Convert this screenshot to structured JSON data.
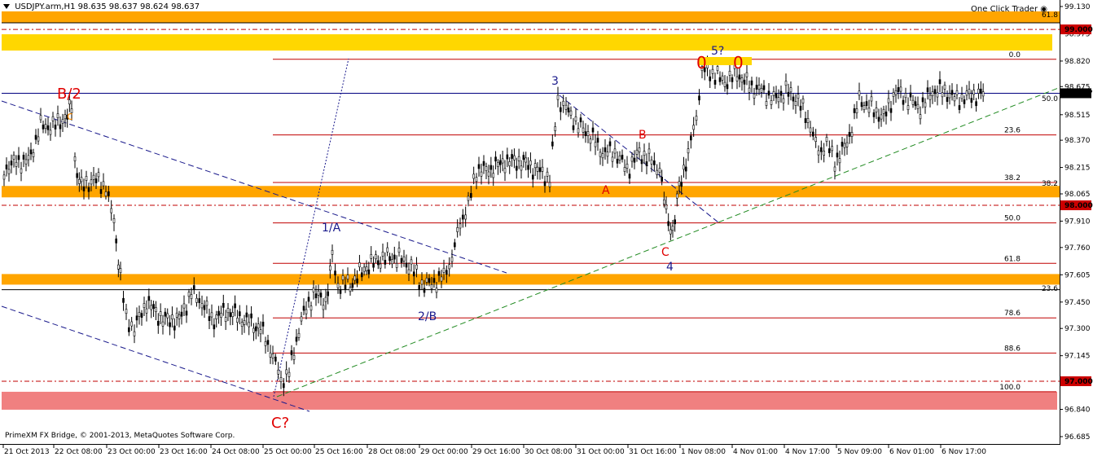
{
  "window": {
    "title": "USDJPY.arm,H1",
    "ohlc": "98.635 98.637 98.624 98.637",
    "one_click": "One Click Trader",
    "copyright": "PrimeXM FX Bridge, © 2001-2013, MetaQuotes Software Corp."
  },
  "price_axis": {
    "ticks": [
      "99.130",
      "98.975",
      "98.820",
      "98.675",
      "98.515",
      "98.370",
      "98.215",
      "98.065",
      "97.910",
      "97.760",
      "97.605",
      "97.450",
      "97.300",
      "97.145",
      "96.990",
      "96.840",
      "96.685"
    ],
    "highlighted": [
      {
        "label": "99.000",
        "bg": "#cc0000"
      },
      {
        "label": "98.637",
        "bg": "#000000"
      },
      {
        "label": "98.000",
        "bg": "#cc0000"
      },
      {
        "label": "97.000",
        "bg": "#cc0000"
      }
    ]
  },
  "time_axis": {
    "ticks": [
      "21 Oct 2013",
      "22 Oct 08:00",
      "23 Oct 00:00",
      "23 Oct 16:00",
      "24 Oct 08:00",
      "25 Oct 00:00",
      "25 Oct 16:00",
      "28 Oct 08:00",
      "29 Oct 00:00",
      "29 Oct 16:00",
      "30 Oct 08:00",
      "31 Oct 00:00",
      "31 Oct 16:00",
      "1 Nov 08:00",
      "4 Nov 01:00",
      "4 Nov 17:00",
      "5 Nov 09:00",
      "6 Nov 01:00",
      "6 Nov 17:00"
    ]
  },
  "fib_levels": [
    "0.0",
    "23.6",
    "38.2",
    "50.0",
    "61.8",
    "78.6",
    "88.6",
    "100.0"
  ],
  "fib_right_levels": [
    "61.8",
    "50.0",
    "38.2",
    "23.6"
  ],
  "wave_labels": {
    "b2": "B/2",
    "c_small": "c",
    "one_a": "1/A",
    "two_b": "2/B",
    "three": "3",
    "a": "A",
    "b": "B",
    "c": "C",
    "four": "4",
    "five": "5?",
    "c_q": "C?",
    "zero1": "0",
    "zero2": "0"
  },
  "colors": {
    "orange_zone": "#ffa500",
    "yellow_zone": "#ffd700",
    "pink_zone": "#f08080",
    "fib_line": "#c00000",
    "price_line": "#000080",
    "trend_green": "#228b22",
    "wave_red": "#e00000",
    "wave_blue": "#1a1a8c"
  },
  "icons": [
    "chart-menu-triangle-icon",
    "one-click-trader-icon"
  ]
}
